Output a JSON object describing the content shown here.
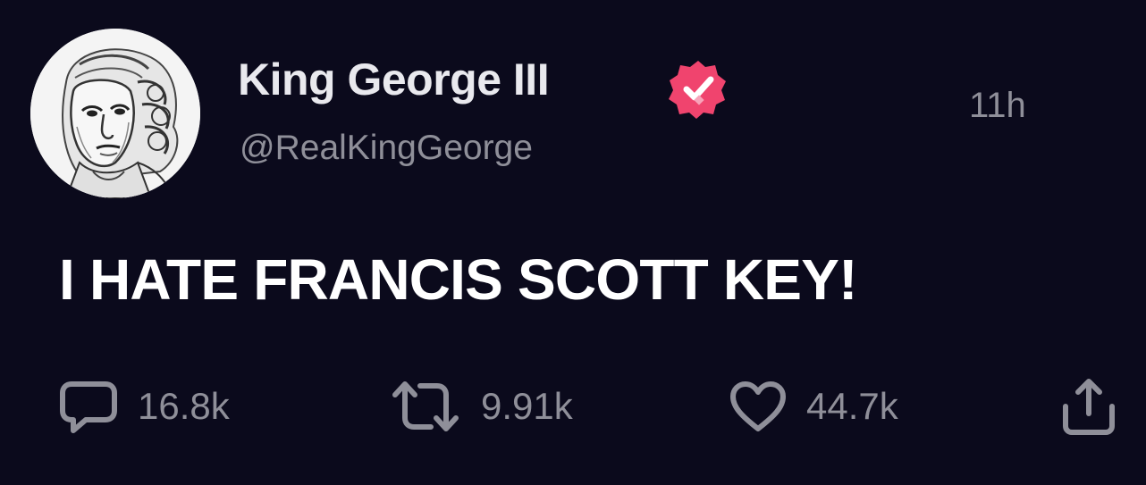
{
  "tweet": {
    "display_name": "King George III",
    "handle": "@RealKingGeorge",
    "timestamp": "11h",
    "text": "I HATE FRANCIS SCOTT KEY!",
    "verified_color": "#f0446e"
  },
  "actions": {
    "replies": "16.8k",
    "retweets": "9.91k",
    "likes": "44.7k"
  },
  "icons": {
    "reply": "speech-bubble-icon",
    "retweet": "retweet-arrows-icon",
    "like": "heart-icon",
    "share": "share-upload-icon",
    "verified": "verified-badge-icon"
  }
}
